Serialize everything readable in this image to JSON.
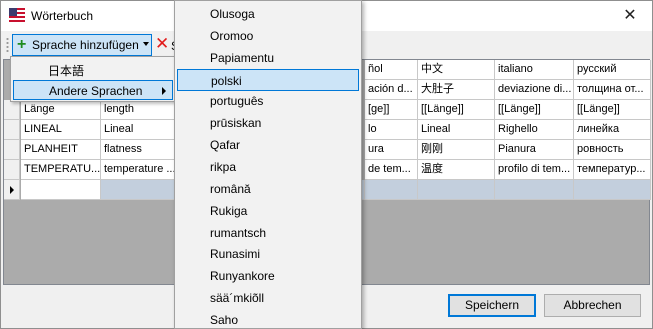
{
  "window": {
    "title": "Wörterbuch",
    "close_icon": "close-icon"
  },
  "toolbar": {
    "add_label": "Sprache hinzufügen",
    "delete_label": "S"
  },
  "dropdown": {
    "items": [
      {
        "label": "日本語"
      },
      {
        "label": "Andere Sprachen"
      }
    ]
  },
  "submenu": {
    "items": [
      "Olusoga",
      "Oromoo",
      "Papiamentu",
      "polski",
      "português",
      "prūsiskan",
      "Qafar",
      "rikpa",
      "română",
      "Rukiga",
      "rumantsch",
      "Runasimi",
      "Runyankore",
      "sää´mkiõll",
      "Saho"
    ],
    "highlighted": "polski"
  },
  "grid": {
    "left_rows": [
      [
        "Länge",
        "length"
      ],
      [
        "LINEAL",
        "Lineal"
      ],
      [
        "PLANHEIT",
        "flatness"
      ],
      [
        "TEMPERATU...",
        "temperature ..."
      ]
    ],
    "right_header": [
      "ñol",
      "中文",
      "italiano",
      "русский"
    ],
    "right_rows": [
      [
        "ación d...",
        "大肚子",
        "deviazione di...",
        "толщина от..."
      ],
      [
        "[ge]]",
        "[[Länge]]",
        "[[Länge]]",
        "[[Länge]]"
      ],
      [
        "lo",
        "Lineal",
        "Righello",
        "линейка"
      ],
      [
        "ura",
        "刚刚",
        "Pianura",
        "ровность"
      ],
      [
        "de tem...",
        "温度",
        "profilo di tem...",
        "температур..."
      ]
    ]
  },
  "buttons": {
    "save": "Speichern",
    "cancel": "Abbrechen"
  },
  "colors": {
    "highlight": "#cce4f7",
    "highlight_border": "#0078d7",
    "selected_row": "#c3cfdd"
  }
}
